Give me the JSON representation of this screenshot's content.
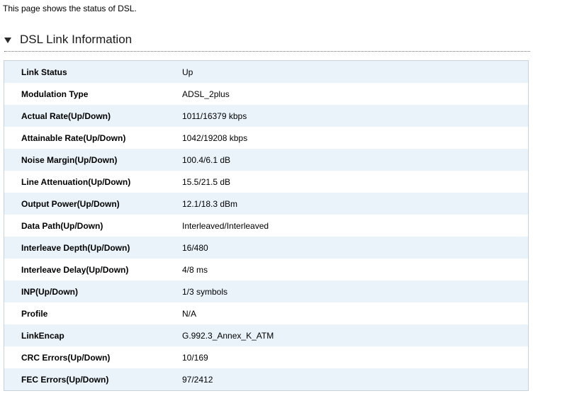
{
  "intro_text": "This page shows the status of DSL.",
  "section": {
    "title": "DSL Link Information"
  },
  "rows": [
    {
      "label": "Link Status",
      "value": "Up"
    },
    {
      "label": "Modulation Type",
      "value": "ADSL_2plus"
    },
    {
      "label": "Actual Rate(Up/Down)",
      "value": "1011/16379 kbps"
    },
    {
      "label": "Attainable Rate(Up/Down)",
      "value": "1042/19208 kbps"
    },
    {
      "label": "Noise Margin(Up/Down)",
      "value": "100.4/6.1 dB"
    },
    {
      "label": "Line Attenuation(Up/Down)",
      "value": "15.5/21.5 dB"
    },
    {
      "label": "Output Power(Up/Down)",
      "value": "12.1/18.3 dBm"
    },
    {
      "label": "Data Path(Up/Down)",
      "value": "Interleaved/Interleaved"
    },
    {
      "label": "Interleave Depth(Up/Down)",
      "value": "16/480"
    },
    {
      "label": "Interleave Delay(Up/Down)",
      "value": "4/8 ms"
    },
    {
      "label": "INP(Up/Down)",
      "value": "1/3 symbols"
    },
    {
      "label": "Profile",
      "value": "N/A"
    },
    {
      "label": "LinkEncap",
      "value": "G.992.3_Annex_K_ATM"
    },
    {
      "label": "CRC Errors(Up/Down)",
      "value": "10/169"
    },
    {
      "label": "FEC Errors(Up/Down)",
      "value": "97/2412"
    }
  ],
  "colors": {
    "row_stripe": "#eaf3fa",
    "table_border": "#c7d3dc"
  },
  "icons": {
    "section_toggle": "triangle-down-icon"
  }
}
